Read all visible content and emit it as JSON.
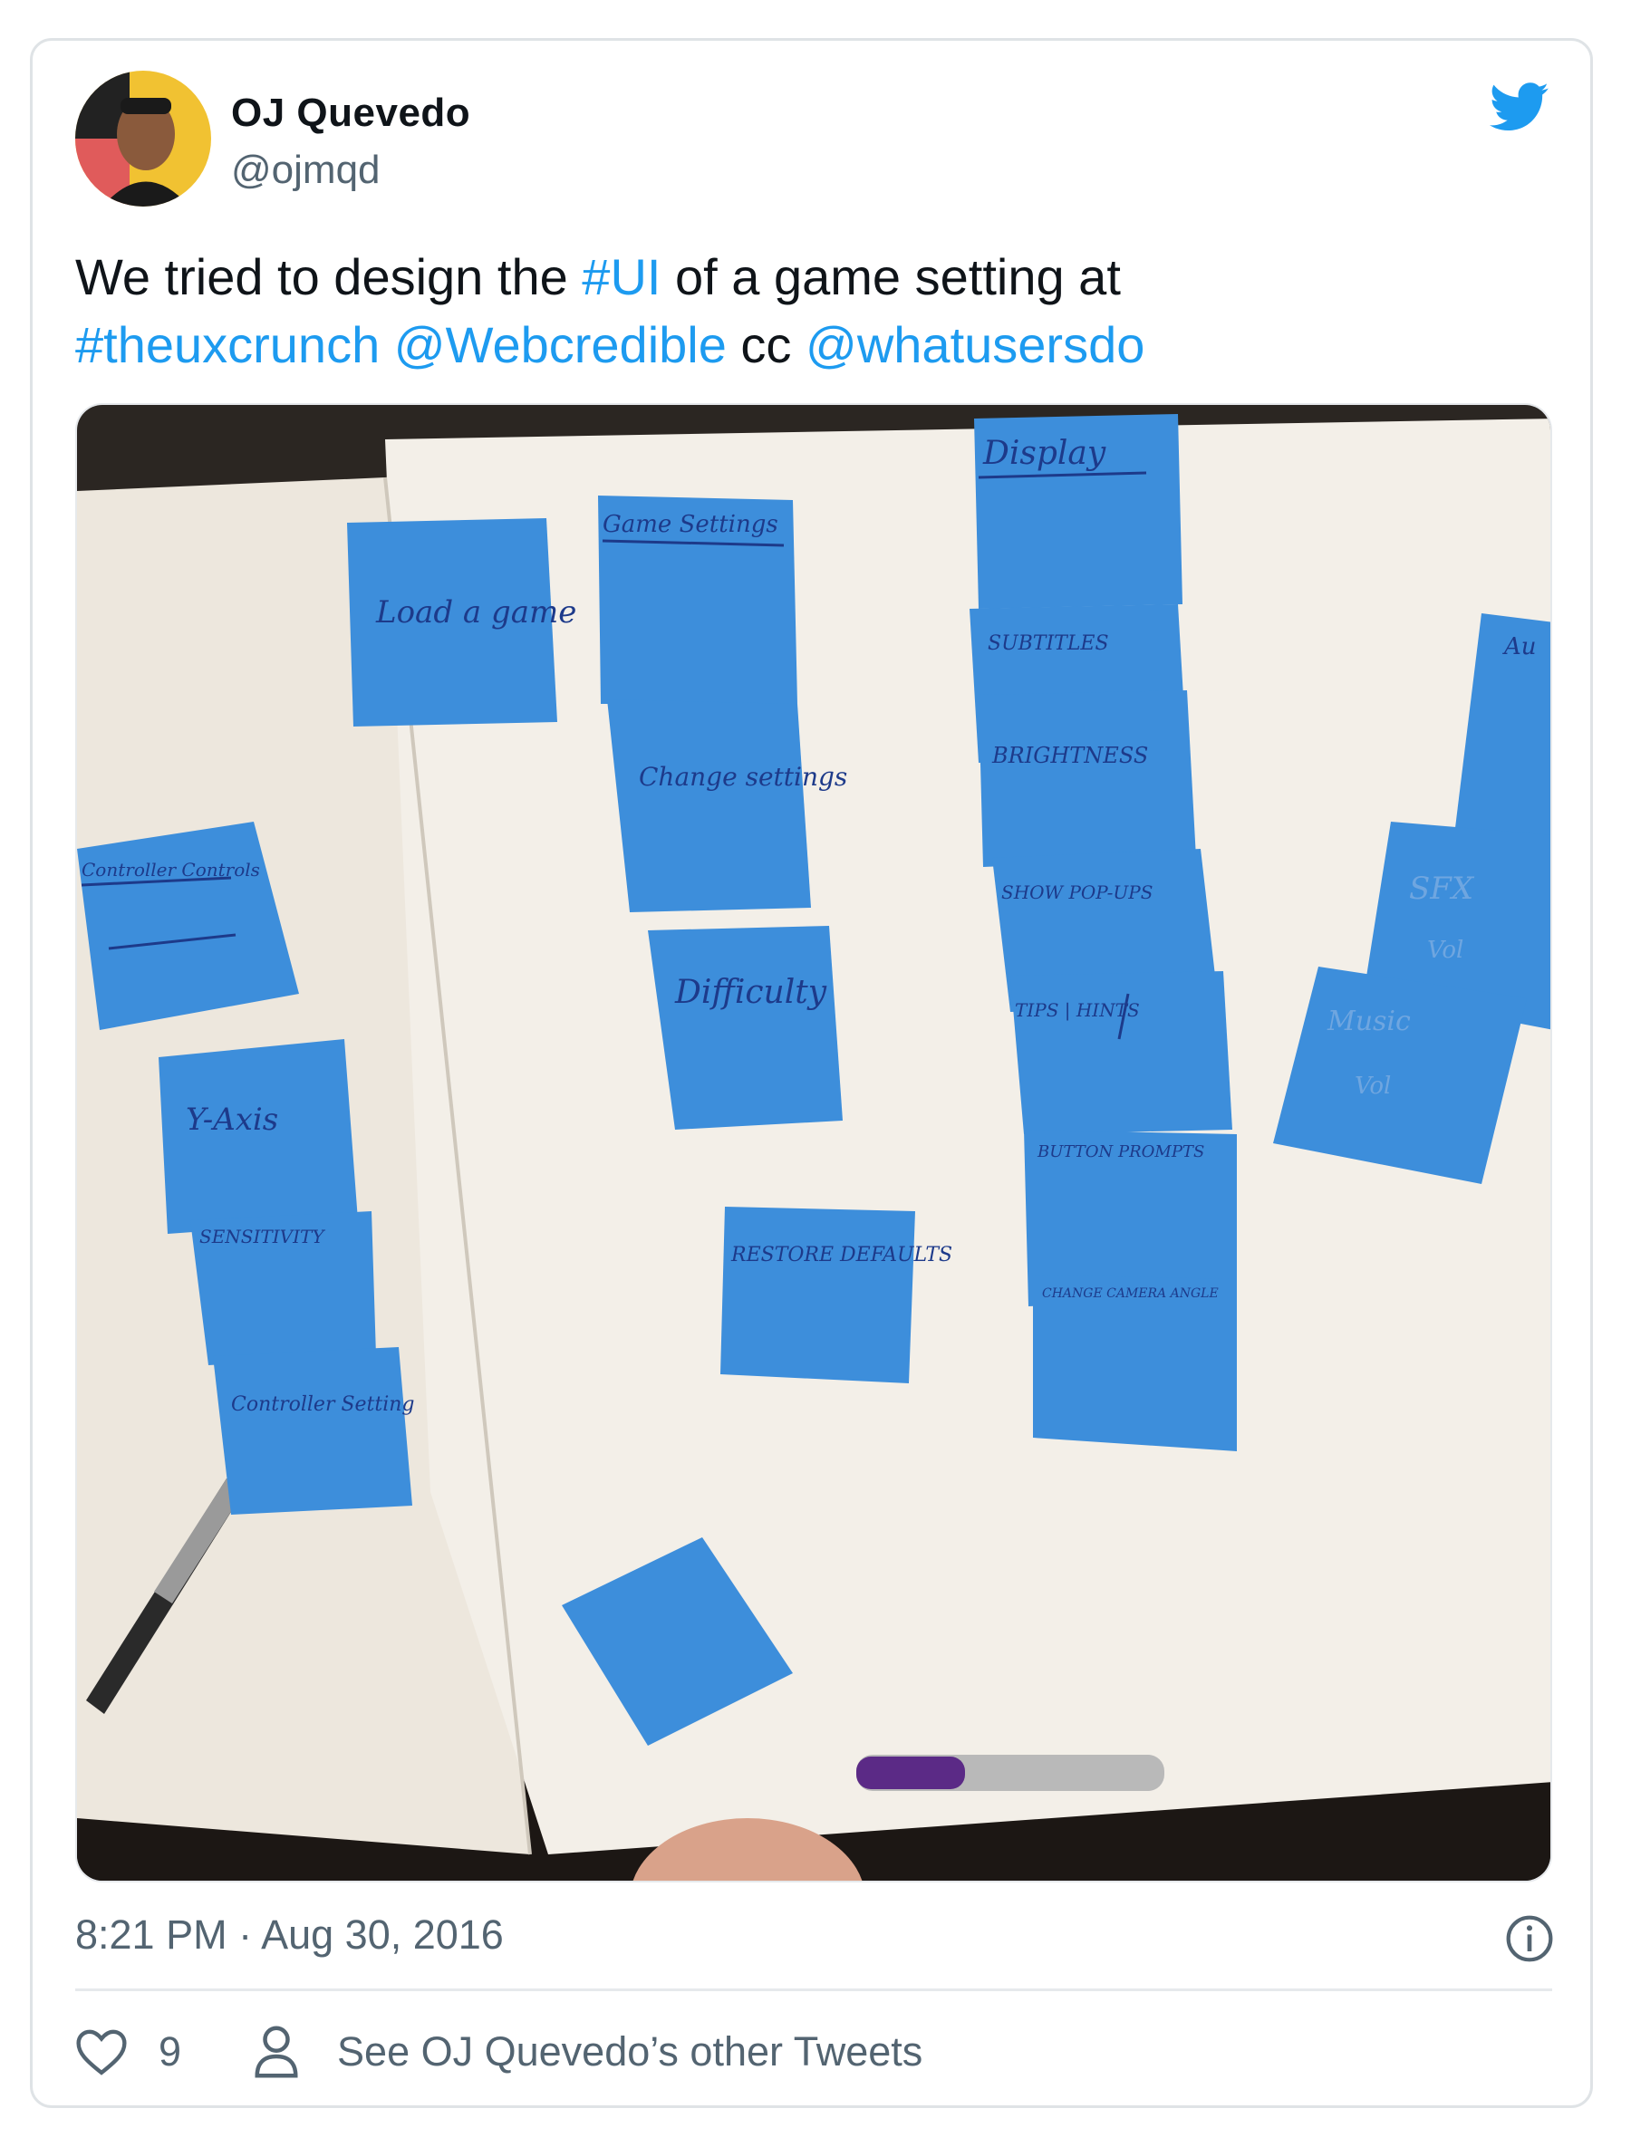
{
  "tweet": {
    "author_name": "OJ Quevedo",
    "author_handle": "@ojmqd",
    "text_parts": {
      "p1": "We tried to design the ",
      "l1": "#UI",
      "p2": " of a game setting at ",
      "l2": "#theuxcrunch",
      "p3": " ",
      "l3": "@Webcredible",
      "p4": " cc ",
      "l4": "@whatusersdo"
    },
    "timestamp": "8:21 PM · Aug 30, 2016",
    "like_count": "9",
    "other_tweets_label": "See OJ Quevedo’s other Tweets"
  },
  "icons": {
    "brand": "twitter-bird-icon",
    "info": "info-icon",
    "like": "heart-icon",
    "profile": "person-icon"
  },
  "colors": {
    "link": "#1d9bf0",
    "secondary_text": "#536471",
    "sticky_note": "#3d8edb"
  },
  "photo": {
    "notes": {
      "load_game": "Load a game",
      "game_settings": "Game Settings",
      "change_settings": "Change settings",
      "difficulty": "Difficulty",
      "restore_defaults": "RESTORE DEFAULTS",
      "display": "Display",
      "subtitles": "SUBTITLES",
      "brightness": "BRIGHTNESS",
      "show_popups": "SHOW POP-UPS",
      "tips_hints": "TIPS | HINTS",
      "button_prompts": "BUTTON PROMPTS",
      "camera_angle": "CHANGE CAMERA ANGLE",
      "controller_controls": "Controller Controls",
      "y_axis": "Y-Axis",
      "sensitivity": "SENSITIVITY",
      "controller_setting": "Controller Setting",
      "sfx": "SFX",
      "sfx_level": "Vol",
      "music": "Music",
      "music_level": "Vol",
      "audio": "Au"
    }
  }
}
